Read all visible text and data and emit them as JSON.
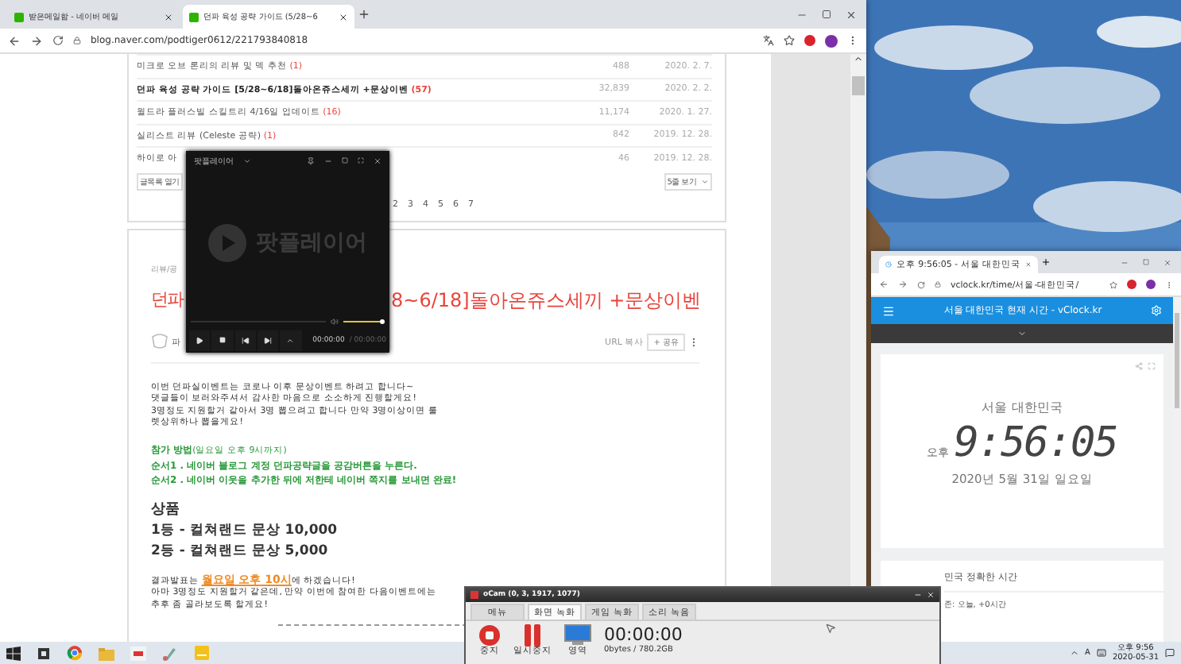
{
  "browser": {
    "tabs": [
      {
        "title": "받은메일함 - 네이버 메일",
        "selected": false
      },
      {
        "title": "던파 육성 공략 가이드 (5/28~6",
        "selected": true
      }
    ],
    "url": "blog.naver.com/podtiger0612/221793840818"
  },
  "post_list": {
    "rows": [
      {
        "title": "미크로 오브 론리의 리뷰 및 덱 추천",
        "comments": "(1)",
        "views": "488",
        "date": "2020. 2. 7.",
        "highlighted": false
      },
      {
        "title": "던파 육성 공략 가이드 [5/28~6/18]돌아온쥬스세끼 +문상이벤",
        "comments": "(57)",
        "views": "32,839",
        "date": "2020. 2. 2.",
        "highlighted": true
      },
      {
        "title": "월드라 플러스빌 스킬트리 4/16일 업데이트",
        "comments": "(16)",
        "views": "11,174",
        "date": "2020. 1. 27.",
        "highlighted": false
      },
      {
        "title": "실리스트 리뷰 (Celeste 공략)",
        "comments": "(1)",
        "views": "842",
        "date": "2019. 12. 28.",
        "highlighted": false
      },
      {
        "title": "하이로 아",
        "comments": "",
        "views": "46",
        "date": "2019. 12. 28.",
        "highlighted": false
      }
    ],
    "open_button": "글목록 열기",
    "rows_select": "5줄 보기",
    "pages": [
      "2",
      "3",
      "4",
      "5",
      "6",
      "7"
    ]
  },
  "post": {
    "category": "리뷰/공",
    "title_parts": [
      "던파",
      "8~6/18]돌아온쥬스세끼 +문상이벤"
    ],
    "author": "파",
    "url_copy": "URL 복사",
    "add_button": "+ 공유",
    "paragraphs": [
      {
        "kind": "small",
        "parts": [
          {
            "text": "이번 던파실이벤트는 코로나 이후 문상이벤트 하려고 합니다~",
            "highlight": false
          }
        ]
      },
      {
        "kind": "small",
        "parts": [
          {
            "text": "댓글들이 보러와주셔서 감사한 마음으로 소소하게 진행할게요!",
            "highlight": false
          }
        ]
      },
      {
        "kind": "small",
        "parts": [
          {
            "text": "3명정도 지원할거 같아서 3명 뽑으려고 합니다 만약 3명이상이면 룰렛상위하나 뽑을게요!",
            "highlight": false
          }
        ]
      },
      {
        "kind": "green",
        "parts": [
          {
            "text": "참가 방법",
            "highlight": false
          },
          {
            "text": "(일요일 오후 9시까지)",
            "highlight": true
          }
        ]
      },
      {
        "kind": "green",
        "parts": [
          {
            "text": "순서1 . 네이버 블로그 계정 던파공략글을 공감버튼을 누른다.",
            "highlight": false
          }
        ]
      },
      {
        "kind": "green",
        "parts": [
          {
            "text": "순서2 . 네이버 이웃을 추가한 뒤에 저한테 네이버 쪽지를 보내면 완료!",
            "highlight": false
          }
        ]
      },
      {
        "kind": "heading",
        "parts": [
          {
            "text": "상품",
            "highlight": false
          }
        ]
      },
      {
        "kind": "prize",
        "parts": [
          {
            "text": "1등 - 컬쳐랜드 문상 10,000",
            "highlight": false
          }
        ]
      },
      {
        "kind": "prize",
        "parts": [
          {
            "text": "2등 - 컬쳐랜드 문상 5,000",
            "highlight": false
          }
        ]
      },
      {
        "kind": "small",
        "parts": [
          {
            "text": "결과발표는 ",
            "highlight": false
          },
          {
            "text": "월요일 오후 10시",
            "highlight": true
          },
          {
            "text": "에 하겠습니다!",
            "highlight": false
          }
        ]
      },
      {
        "kind": "small",
        "parts": [
          {
            "text": "아마 3명정도 지원할거 같은데, 만약 이번에 참여한 다음이벤트에는 추후 좀 골라보도록 할게요!",
            "highlight": false
          }
        ]
      }
    ]
  },
  "player": {
    "title": "팟플레이어",
    "logo_text": "팟플레이어",
    "volume": {
      "level": 0.95
    },
    "time": "00:00:00",
    "duration": "/ 00:00:00"
  },
  "clock": {
    "tab": "오후 9:56:05 - 서울 대한민국",
    "url": "vclock.kr/time/서울-대한민국/",
    "header": "서울 대한민국 현재 시간 - vClock.kr",
    "city": "서울 대한민국",
    "ampm": "오후",
    "time": "9:56:05",
    "date": "2020년 5월 31일 일요일",
    "section_title": "민국 정확한 시간",
    "section_line": "존: 오늘, +0시간"
  },
  "ocam": {
    "title": "oCam (0, 3, 1917, 1077)",
    "tabs": [
      {
        "label": "메뉴",
        "selected": false
      },
      {
        "label": "화면 녹화",
        "selected": true
      },
      {
        "label": "게임 녹화",
        "selected": false
      },
      {
        "label": "소리 녹음",
        "selected": false
      }
    ],
    "buttons": [
      {
        "kind": "stop",
        "label": "중지"
      },
      {
        "kind": "pause",
        "label": "일시중지"
      },
      {
        "kind": "area",
        "label": "영역"
      }
    ],
    "elapsed": "00:00:00",
    "storage": "0bytes / 780.2GB"
  },
  "taskbar": {
    "apps": [
      {
        "kind": "taskview"
      },
      {
        "kind": "chrome"
      },
      {
        "kind": "folder"
      },
      {
        "kind": "red"
      },
      {
        "kind": "paint"
      },
      {
        "kind": "notes"
      }
    ],
    "ime": "A",
    "time": "오후 9:56",
    "date": "2020-05-31"
  }
}
